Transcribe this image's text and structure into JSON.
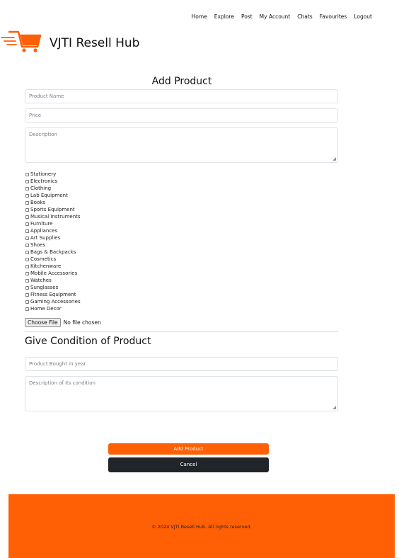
{
  "nav": {
    "items": [
      "Home",
      "Explore",
      "Post",
      "My Account",
      "Chats",
      "Favourites",
      "Logout"
    ]
  },
  "brand": {
    "title": "VJTI Resell Hub",
    "logo_icon": "shopping-cart-icon",
    "logo_color": "#ff5f05"
  },
  "form": {
    "title": "Add Product",
    "product_name_placeholder": "Product Name",
    "price_placeholder": "Price",
    "description_placeholder": "Description",
    "categories": [
      "Stationery",
      "Electronics",
      "Clothing",
      "Lab Equipment",
      "Books",
      "Sports Equipment",
      "Musical Instruments",
      "Furniture",
      "Appliances",
      "Art Supplies",
      "Shoes",
      "Bags & Backpacks",
      "Cosmetics",
      "Kitchenware",
      "Mobile Accessories",
      "Watches",
      "Sunglasses",
      "Fitness Equipment",
      "Gaming Accessories",
      "Home Decor"
    ],
    "file_button": "Choose File",
    "file_status": "No file chosen"
  },
  "condition": {
    "title": "Give Condition of Product",
    "year_placeholder": "Product Bought in year",
    "description_placeholder": "Description of its condition"
  },
  "actions": {
    "add_label": "Add Product",
    "cancel_label": "Cancel"
  },
  "footer": {
    "text": "© 2024 VJTI Resell Hub. All rights reserved."
  },
  "colors": {
    "accent": "#ff5f05",
    "dark": "#212529"
  }
}
